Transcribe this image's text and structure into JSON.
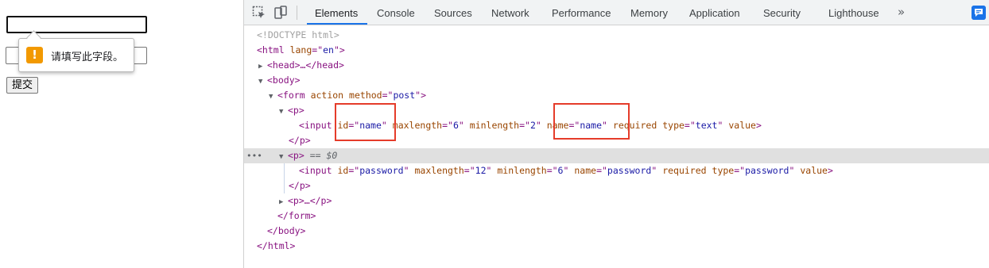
{
  "page_preview": {
    "name_input_value": "",
    "password_input_value": "",
    "submit_label": "提交",
    "tooltip": {
      "icon": "warning-icon",
      "text": "请填写此字段。"
    }
  },
  "devtools": {
    "tabs": [
      {
        "label": "Elements",
        "active": true
      },
      {
        "label": "Console"
      },
      {
        "label": "Sources"
      },
      {
        "label": "Network"
      },
      {
        "label": "Performance"
      },
      {
        "label": "Memory"
      },
      {
        "label": "Application"
      },
      {
        "label": "Security"
      },
      {
        "label": "Lighthouse"
      }
    ],
    "more_tabs": "»",
    "dom": {
      "doctype": "<!DOCTYPE html>",
      "html_open": {
        "tag": "<html",
        "attr": "lang",
        "val": "en",
        "close": ">"
      },
      "head_collapsed": "<head>…</head>",
      "body_open": "<body>",
      "form_open": {
        "tag": "<form",
        "a1": "action",
        "a2": "method",
        "v2": "post",
        "close": ">"
      },
      "p_open": "<p>",
      "input1": {
        "tag": "<input",
        "a_id": "id",
        "v_id": "name",
        "a_max": "maxlength",
        "v_max": "6",
        "a_min": "minlength",
        "v_min": "2",
        "a_name": "name",
        "v_name": "name",
        "a_req": "required",
        "a_type": "type",
        "v_type": "text",
        "a_val": "value",
        "close": ">"
      },
      "p_close": "</p>",
      "selected_p": {
        "tag": "<p>",
        "hint": "== $0"
      },
      "input2": {
        "tag": "<input",
        "a_id": "id",
        "v_id": "password",
        "a_max": "maxlength",
        "v_max": "12",
        "a_min": "minlength",
        "v_min": "6",
        "a_name": "name",
        "v_name": "password",
        "a_req": "required",
        "a_type": "type",
        "v_type": "password",
        "a_val": "value",
        "close": ">"
      },
      "p_collapsed": "<p>…</p>",
      "form_close": "</form>",
      "body_close": "</body>",
      "html_close": "</html>",
      "ellipsis": "•••"
    },
    "highlight_color": "#e53c2a"
  }
}
